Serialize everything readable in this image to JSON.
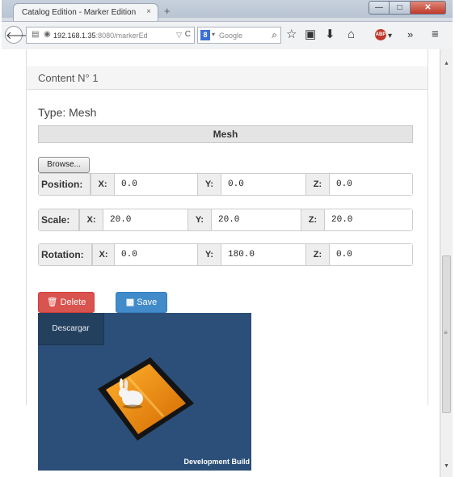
{
  "browser": {
    "tab_title": "Catalog Edition - Marker Edition",
    "tab_close": "×",
    "new_tab": "+",
    "url_host": "192.168.1.35",
    "url_rest": ":8080/markerEd",
    "url_dropdown": "▽",
    "reload": "C",
    "search_engine_letter": "8",
    "search_dropdown": "▾",
    "search_placeholder": "Google",
    "window_min": "—",
    "window_max": "□",
    "window_close": "✕"
  },
  "content": {
    "heading": "Content N° 1",
    "type_text": "Type: Mesh",
    "mesh_header": "Mesh",
    "browse_label": "Browse...",
    "rows": [
      {
        "label": "Position:",
        "x_label": "X:",
        "x": "0.0",
        "y_label": "Y:",
        "y": "0.0",
        "z_label": "Z:",
        "z": "0.0"
      },
      {
        "label": "Scale:",
        "x_label": "X:",
        "x": "20.0",
        "y_label": "Y:",
        "y": "20.0",
        "z_label": "Z:",
        "z": "20.0"
      },
      {
        "label": "Rotation:",
        "x_label": "X:",
        "x": "0.0",
        "y_label": "Y:",
        "y": "180.0",
        "z_label": "Z:",
        "z": "0.0"
      }
    ],
    "delete_label": "Delete",
    "save_label": "Save",
    "download_label": "Descargar",
    "dev_build_label": "Development Build"
  },
  "colors": {
    "delete": "#d9534f",
    "save": "#428bca",
    "unity_bg": "#2b4f78",
    "marker": "#f08a00"
  }
}
